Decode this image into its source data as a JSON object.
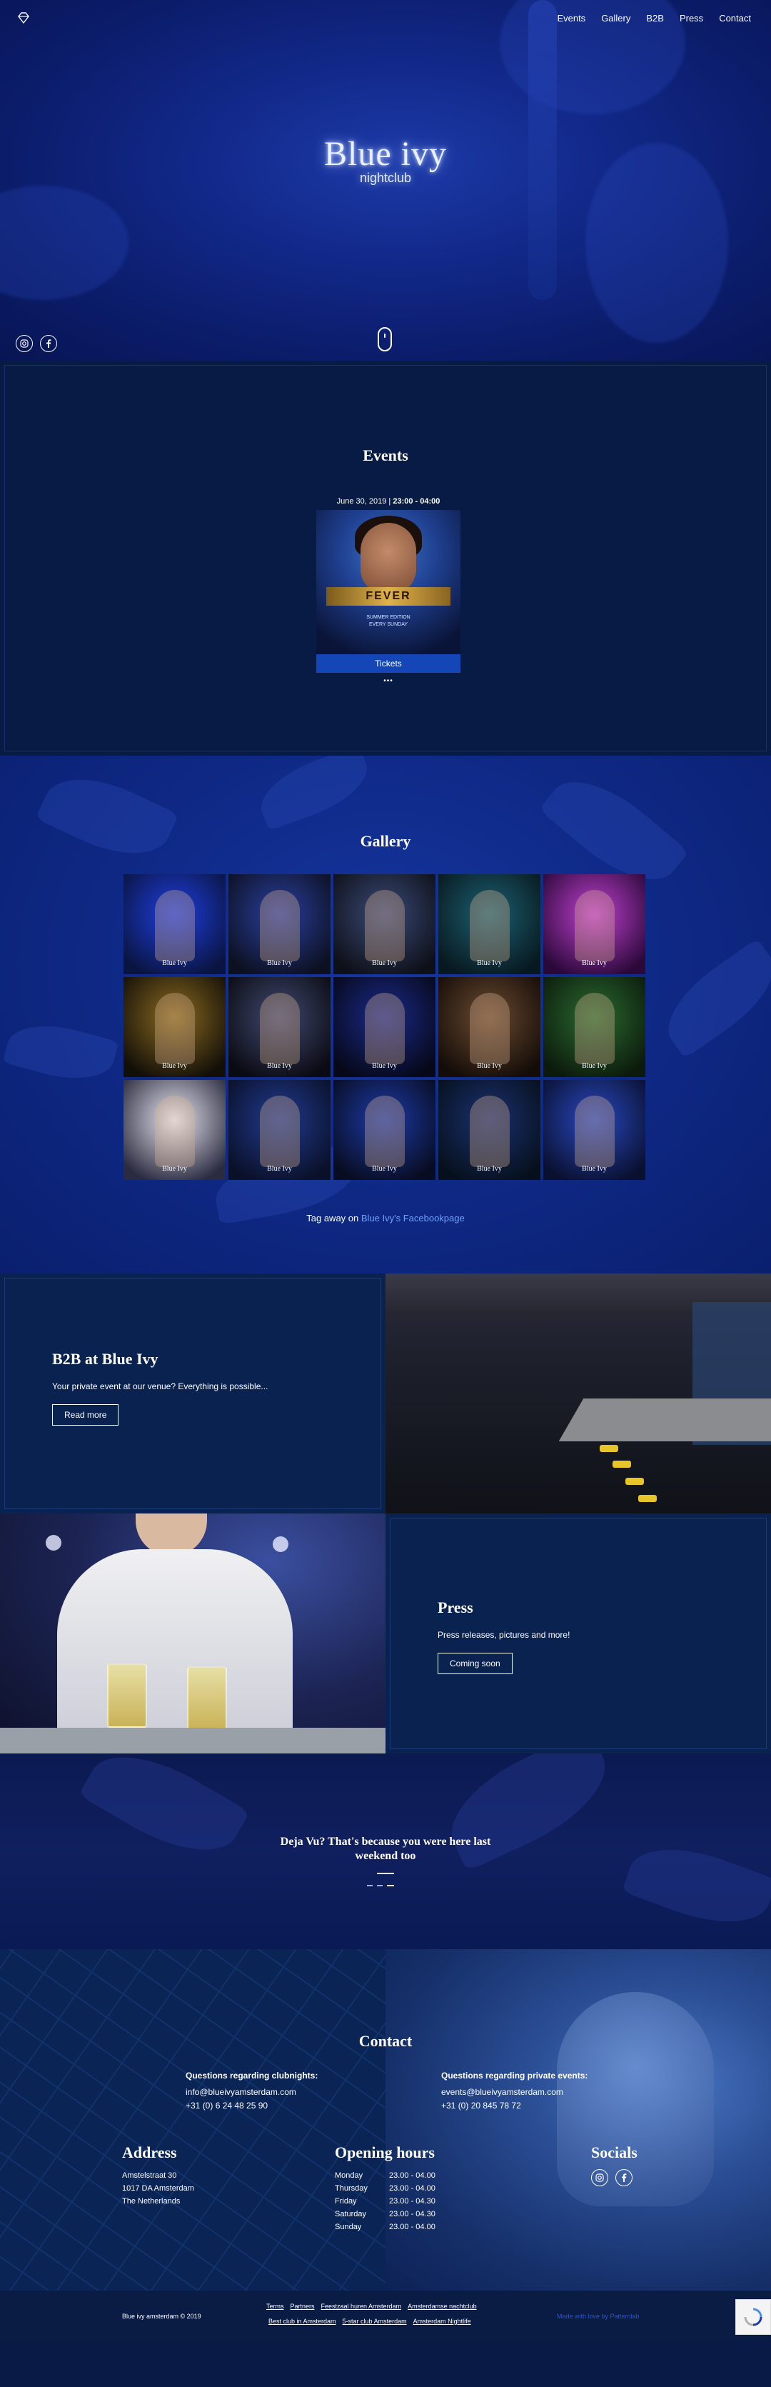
{
  "nav": {
    "logo_icon": "diamond-icon",
    "items": [
      {
        "label": "Events"
      },
      {
        "label": "Gallery"
      },
      {
        "label": "B2B"
      },
      {
        "label": "Press"
      },
      {
        "label": "Contact"
      }
    ]
  },
  "hero": {
    "brand": "Blue ivy",
    "sub": "nightclub",
    "social_icons": [
      "instagram-icon",
      "facebook-icon"
    ]
  },
  "events": {
    "title": "Events",
    "card": {
      "date": "June 30, 2019",
      "time": "23:00 - 04:00",
      "poster_headline": "FEVER",
      "poster_lines": [
        "SUMMER EDITION",
        "EVERY SUNDAY"
      ],
      "tickets_label": "Tickets"
    },
    "more": "•••"
  },
  "gallery": {
    "title": "Gallery",
    "watermark": "Blue Ivy",
    "tiles": [
      {
        "c1": "#1e3ee0",
        "c2": "#0a1440"
      },
      {
        "c1": "#2a3fa0",
        "c2": "#0c1020"
      },
      {
        "c1": "#3a4a78",
        "c2": "#0e1018"
      },
      {
        "c1": "#1c6070",
        "c2": "#081820"
      },
      {
        "c1": "#c040d0",
        "c2": "#2a0838"
      },
      {
        "c1": "#8a6a20",
        "c2": "#120e08"
      },
      {
        "c1": "#404a70",
        "c2": "#0a0a12"
      },
      {
        "c1": "#1a2a8a",
        "c2": "#060818"
      },
      {
        "c1": "#6a4a30",
        "c2": "#140c08"
      },
      {
        "c1": "#2a6a30",
        "c2": "#0c1a0c"
      },
      {
        "c1": "#e8e8f0",
        "c2": "#2a2a40"
      },
      {
        "c1": "#203a90",
        "c2": "#0a1028"
      },
      {
        "c1": "#1c3aa8",
        "c2": "#080c20"
      },
      {
        "c1": "#1a3070",
        "c2": "#06101c"
      },
      {
        "c1": "#2848c0",
        "c2": "#0a1030"
      }
    ],
    "tag_text": "Tag away on",
    "tag_link": "Blue Ivy's Facebookpage"
  },
  "b2b": {
    "title": "B2B at Blue Ivy",
    "text": "Your private event at our venue? Everything is possible...",
    "button": "Read more"
  },
  "press": {
    "title": "Press",
    "text": "Press releases, pictures and more!",
    "button": "Coming soon"
  },
  "deja": {
    "line1": "Deja Vu? That's because you were here last",
    "line2": "weekend too"
  },
  "contact": {
    "title": "Contact",
    "clubnights": {
      "heading": "Questions regarding clubnights:",
      "email": "info@blueivyamsterdam.com",
      "phone": "+31 (0) 6 24 48 25 90"
    },
    "private": {
      "heading": "Questions regarding private events:",
      "email": "events@blueivyamsterdam.com",
      "phone": "+31 (0) 20 845 78 72"
    },
    "address": {
      "heading": "Address",
      "line1": "Amstelstraat 30",
      "line2": "1017 DA Amsterdam",
      "line3": "The Netherlands"
    },
    "hours": {
      "heading": "Opening hours",
      "rows": [
        {
          "day": "Monday",
          "time": "23.00 - 04.00"
        },
        {
          "day": "Thursday",
          "time": "23.00 - 04.00"
        },
        {
          "day": "Friday",
          "time": "23.00 - 04.30"
        },
        {
          "day": "Saturday",
          "time": "23.00 - 04.30"
        },
        {
          "day": "Sunday",
          "time": "23.00 - 04.00"
        }
      ]
    },
    "socials": {
      "heading": "Socials",
      "icons": [
        "instagram-icon",
        "facebook-icon"
      ]
    }
  },
  "footer": {
    "copyright": "Blue ivy amsterdam © 2019",
    "links_row1": [
      "Terms",
      "Partners",
      "Feestzaal huren Amsterdam",
      "Amsterdamse nachtclub"
    ],
    "links_row2": [
      "Best club in Amsterdam",
      "5-star club Amsterdam",
      "Amsterdam Nightlife"
    ],
    "credit": "Made with love by Patternlab"
  },
  "colors": {
    "accent": "#1446b8",
    "link": "#6da2ff",
    "panel": "#0a2250",
    "footer": "#0a1b44"
  }
}
